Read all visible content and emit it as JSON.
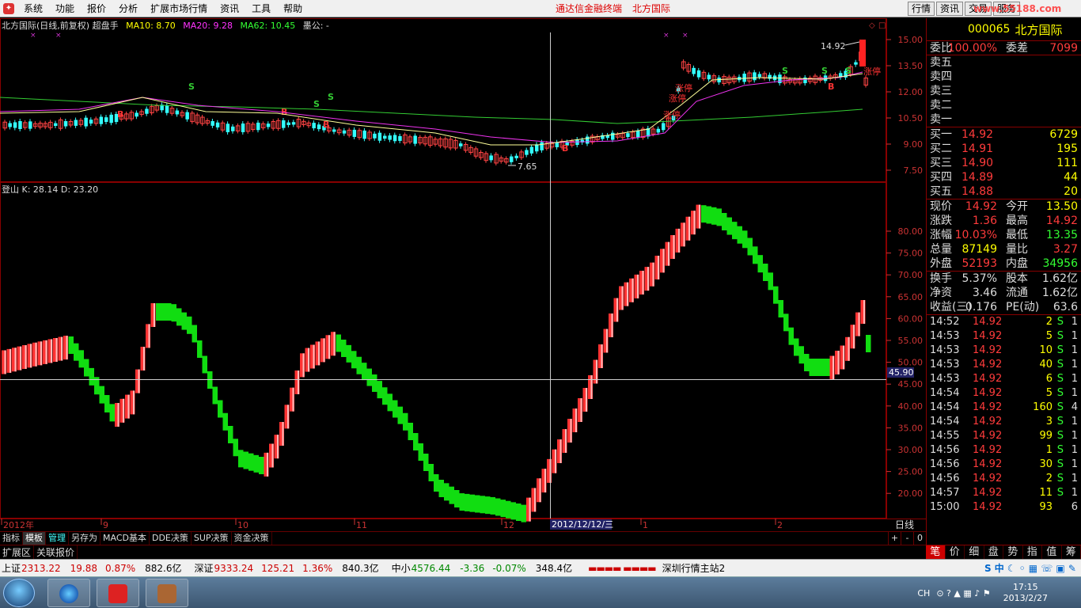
{
  "menubar": {
    "items": [
      "系统",
      "功能",
      "报价",
      "分析",
      "扩展市场行情",
      "资讯",
      "工具",
      "帮助"
    ],
    "brand": "通达信金融终端",
    "stock_name": "北方国际",
    "right_buttons": [
      "行情",
      "资讯",
      "交易",
      "服务"
    ],
    "watermark": "www.55188.com"
  },
  "upper_chart": {
    "legend": {
      "title": "北方国际(日线,前复权) 超盘手",
      "ma10": "MA10: 8.70",
      "ma20": "MA20: 9.28",
      "ma62": "MA62: 10.45",
      "extra": "墨公: -"
    },
    "price_labels": [
      "15.00",
      "13.50",
      "12.00",
      "10.50",
      "9.00",
      "7.50"
    ],
    "high_marker": "14.92",
    "low_marker": "7.65",
    "zt_labels": [
      "涨停",
      "涨停",
      "涨停",
      "涨停"
    ]
  },
  "lower_chart": {
    "legend": "登山  K: 28.14  D: 23.20",
    "labels": [
      "80.00",
      "75.00",
      "70.00",
      "65.00",
      "60.00",
      "55.00",
      "50.00",
      "45.00",
      "40.00",
      "35.00",
      "30.00",
      "25.00",
      "20.00"
    ],
    "crosshair_value": "45.90"
  },
  "xaxis": {
    "labels": [
      "2012年",
      "9",
      "10",
      "11",
      "12",
      "1",
      "2"
    ],
    "cursor_date": "2012/12/12/三",
    "period": "日线"
  },
  "tabs": {
    "items": [
      "指标",
      "模板",
      "管理",
      "另存为",
      "MACD基本",
      "DDE决策",
      "SUP决策",
      "资金决策"
    ],
    "controls": [
      "+",
      "-",
      "0"
    ]
  },
  "ext_row": [
    "扩展区",
    "关联报价"
  ],
  "quote": {
    "code": "000065",
    "name": "北方国际",
    "wei_bi_label": "委比",
    "wei_bi": "100.00%",
    "wei_cha_label": "委差",
    "wei_cha": "7099",
    "sell": [
      {
        "label": "卖五",
        "price": "",
        "vol": ""
      },
      {
        "label": "卖四",
        "price": "",
        "vol": ""
      },
      {
        "label": "卖三",
        "price": "",
        "vol": ""
      },
      {
        "label": "卖二",
        "price": "",
        "vol": ""
      },
      {
        "label": "卖一",
        "price": "",
        "vol": ""
      }
    ],
    "buy": [
      {
        "label": "买一",
        "price": "14.92",
        "vol": "6729"
      },
      {
        "label": "买二",
        "price": "14.91",
        "vol": "195"
      },
      {
        "label": "买三",
        "price": "14.90",
        "vol": "111"
      },
      {
        "label": "买四",
        "price": "14.89",
        "vol": "44"
      },
      {
        "label": "买五",
        "price": "14.88",
        "vol": "20"
      }
    ],
    "stats": [
      [
        "现价",
        "14.92",
        "今开",
        "13.50"
      ],
      [
        "涨跌",
        "1.36",
        "最高",
        "14.92"
      ],
      [
        "涨幅",
        "10.03%",
        "最低",
        "13.35"
      ],
      [
        "总量",
        "87149",
        "量比",
        "3.27"
      ],
      [
        "外盘",
        "52193",
        "内盘",
        "34956"
      ]
    ],
    "fund": [
      [
        "换手",
        "5.37%",
        "股本",
        "1.62亿"
      ],
      [
        "净资",
        "3.46",
        "流通",
        "1.62亿"
      ],
      [
        "收益(三)",
        "0.176",
        "PE(动)",
        "63.6"
      ]
    ],
    "ticks": [
      [
        "14:52",
        "14.92",
        "2",
        "S",
        "1"
      ],
      [
        "14:53",
        "14.92",
        "5",
        "S",
        "1"
      ],
      [
        "14:53",
        "14.92",
        "10",
        "S",
        "1"
      ],
      [
        "14:53",
        "14.92",
        "40",
        "S",
        "1"
      ],
      [
        "14:53",
        "14.92",
        "6",
        "S",
        "1"
      ],
      [
        "14:54",
        "14.92",
        "5",
        "S",
        "1"
      ],
      [
        "14:54",
        "14.92",
        "160",
        "S",
        "4"
      ],
      [
        "14:54",
        "14.92",
        "3",
        "S",
        "1"
      ],
      [
        "14:55",
        "14.92",
        "99",
        "S",
        "1"
      ],
      [
        "14:56",
        "14.92",
        "1",
        "S",
        "1"
      ],
      [
        "14:56",
        "14.92",
        "30",
        "S",
        "1"
      ],
      [
        "14:56",
        "14.92",
        "2",
        "S",
        "1"
      ],
      [
        "14:57",
        "14.92",
        "11",
        "S",
        "1"
      ],
      [
        "15:00",
        "14.92",
        "93",
        "",
        "6"
      ]
    ],
    "bottom_tabs": [
      "笔",
      "价",
      "细",
      "盘",
      "势",
      "指",
      "值",
      "筹"
    ]
  },
  "status": {
    "sh_label": "上证",
    "sh_index": "2313.22",
    "sh_chg": "19.88",
    "sh_pct": "0.87%",
    "sh_amt": "882.6亿",
    "sz_label": "深证",
    "sz_index": "9333.24",
    "sz_chg": "125.21",
    "sz_pct": "1.36%",
    "sz_amt": "840.3亿",
    "zx_label": "中小",
    "zx_index": "4576.44",
    "zx_chg": "-3.36",
    "zx_pct": "-0.07%",
    "zx_amt": "348.4亿",
    "server": "深圳行情主站2"
  },
  "taskbar": {
    "time": "17:15",
    "date": "2013/2/27",
    "lang": "CH"
  }
}
